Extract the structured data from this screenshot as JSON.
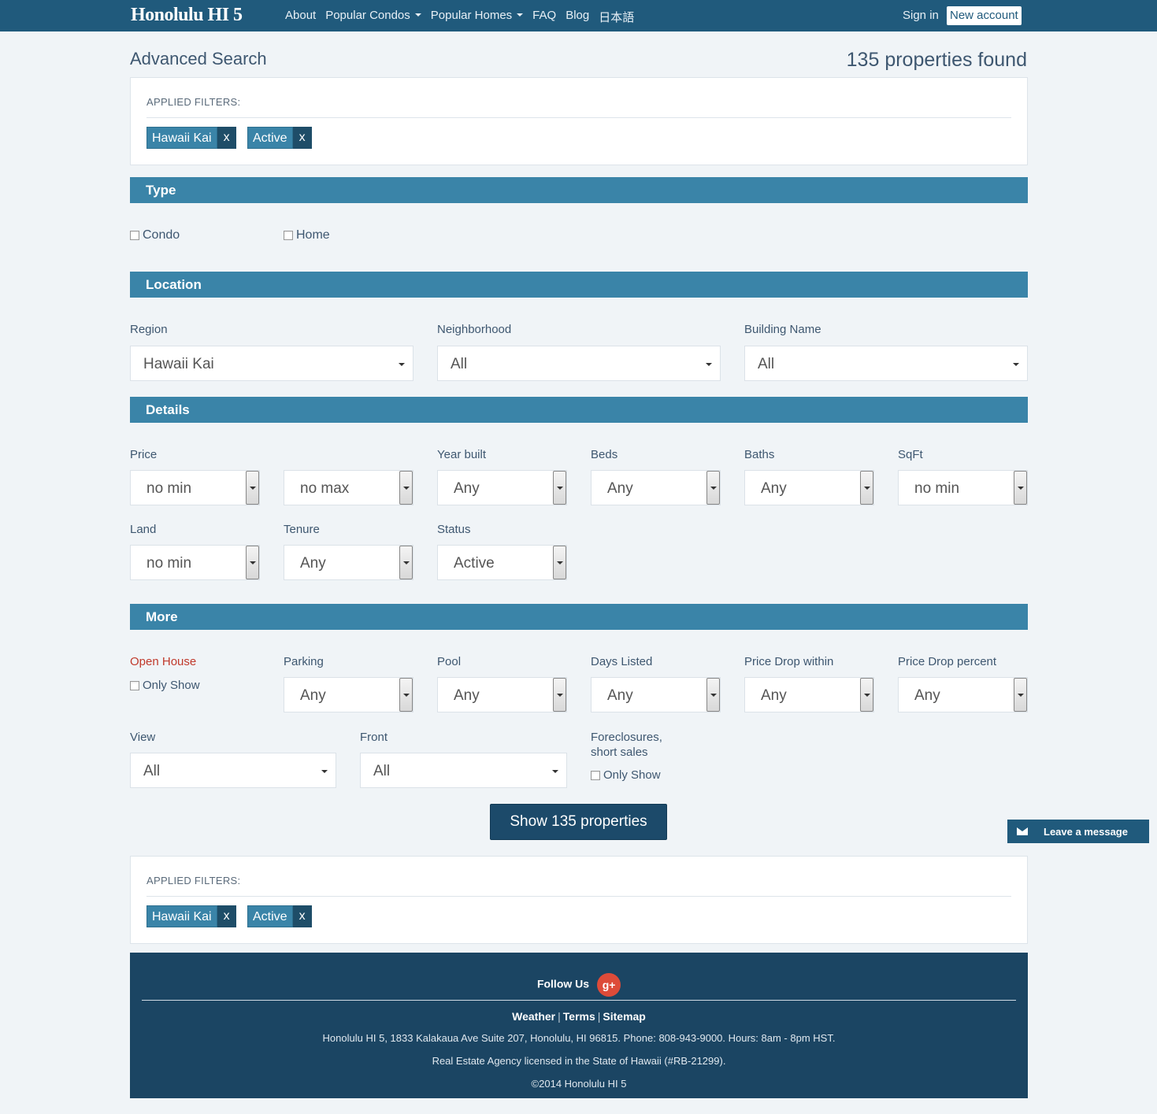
{
  "nav": {
    "logo": "Honolulu HI 5",
    "links": [
      "About",
      "Popular Condos",
      "Popular Homes",
      "FAQ",
      "Blog",
      "日本語"
    ],
    "sign_in": "Sign in",
    "new_account": "New account"
  },
  "header": {
    "title": "Advanced Search",
    "found": "135 properties found"
  },
  "filters": {
    "label": "APPLIED FILTERS:",
    "chips": [
      "Hawaii Kai",
      "Active"
    ],
    "remove": "x"
  },
  "sections": {
    "type": "Type",
    "location": "Location",
    "details": "Details",
    "more": "More"
  },
  "type": {
    "condo": "Condo",
    "home": "Home"
  },
  "location": {
    "region_label": "Region",
    "region_value": "Hawaii Kai",
    "neighborhood_label": "Neighborhood",
    "neighborhood_value": "All",
    "building_label": "Building Name",
    "building_value": "All"
  },
  "details": {
    "price_label": "Price",
    "price_min": "no min",
    "price_max": "no max",
    "year_label": "Year built",
    "year_value": "Any",
    "beds_label": "Beds",
    "beds_value": "Any",
    "baths_label": "Baths",
    "baths_value": "Any",
    "sqft_label": "SqFt",
    "sqft_value": "no min",
    "land_label": "Land",
    "land_value": "no min",
    "tenure_label": "Tenure",
    "tenure_value": "Any",
    "status_label": "Status",
    "status_value": "Active"
  },
  "more": {
    "open_house_label": "Open House",
    "only_show": "Only Show",
    "parking_label": "Parking",
    "parking_value": "Any",
    "pool_label": "Pool",
    "pool_value": "Any",
    "days_label": "Days Listed",
    "days_value": "Any",
    "drop_within_label": "Price Drop within",
    "drop_within_value": "Any",
    "drop_percent_label": "Price Drop percent",
    "drop_percent_value": "Any",
    "view_label": "View",
    "view_value": "All",
    "front_label": "Front",
    "front_value": "All",
    "foreclosures_label_1": "Foreclosures,",
    "foreclosures_label_2": "short sales"
  },
  "show_button": "Show 135 properties",
  "leave_message": "Leave a message",
  "footer": {
    "follow": "Follow Us",
    "gplus": "g+",
    "links": [
      "Weather",
      "Terms",
      "Sitemap"
    ],
    "sep": "|",
    "address": "Honolulu HI 5, 1833 Kalakaua Ave Suite 207, Honolulu, HI 96815. Phone: 808-943-9000. Hours: 8am - 8pm HST.",
    "license": "Real Estate Agency licensed in the State of Hawaii (#RB-21299).",
    "copyright": "©2014 Honolulu HI 5"
  },
  "colors": {
    "nav": "#205a7c",
    "section": "#3a84a8",
    "chip": "#3a84a8",
    "chip_x": "#1e4d68",
    "footer": "#1b4563",
    "accent_red": "#c0392b"
  }
}
